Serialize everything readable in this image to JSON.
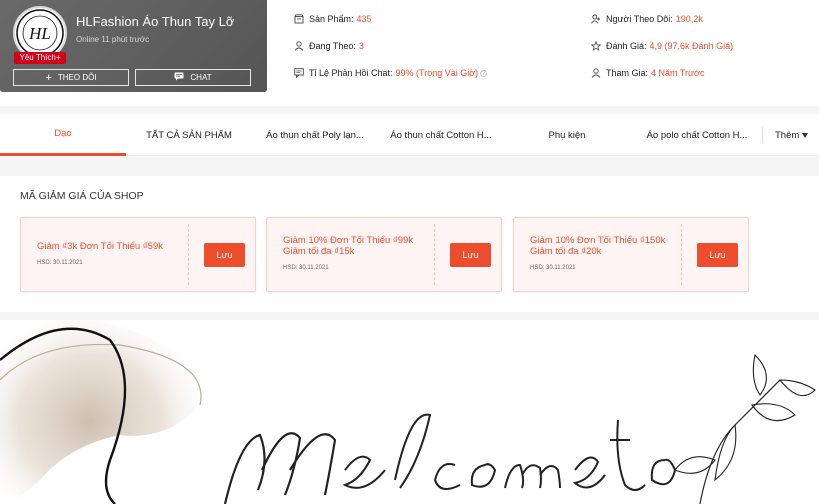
{
  "shop": {
    "name": "HLFashion Áo Thun Tay Lỡ",
    "online": "Online 11 phút trước",
    "badge": "Yêu Thích+",
    "logo_text": "HL",
    "follow_label": "THEO DÕI",
    "chat_label": "CHAT"
  },
  "stats": {
    "products": {
      "label": "Sản Phẩm:",
      "value": "435"
    },
    "following": {
      "label": "Đang Theo:",
      "value": "3"
    },
    "chat_rate": {
      "label": "Tỉ Lệ Phản Hồi Chat:",
      "value": "99% (Trong Vài Giờ)"
    },
    "followers": {
      "label": "Người Theo Dõi:",
      "value": "190,2k"
    },
    "rating": {
      "label": "Đánh Giá:",
      "value": "4,9 (97,6k Đánh Giá)"
    },
    "joined": {
      "label": "Tham Gia:",
      "value": "4 Năm Trước"
    }
  },
  "tabs": [
    {
      "label": "Dạo"
    },
    {
      "label": "TẤT CẢ SẢN PHẨM"
    },
    {
      "label": "Áo thun chất Poly lạn..."
    },
    {
      "label": "Áo thun chất Cotton H..."
    },
    {
      "label": "Phụ kiện"
    },
    {
      "label": "Áo polo chất Cotton H..."
    },
    {
      "label": "Thêm"
    }
  ],
  "vouchers": {
    "title": "MÃ GIẢM GIÁ CỦA SHOP",
    "items": [
      {
        "line1": "Giảm ₫3k Đơn Tối Thiểu ₫59k",
        "line2": "",
        "expiry": "HSD: 30.11.2021",
        "save": "Lưu"
      },
      {
        "line1": "Giảm 10% Đơn Tối Thiểu ₫99k",
        "line2": "Giảm tối đa ₫15k",
        "expiry": "HSD: 30.11.2021",
        "save": "Lưu"
      },
      {
        "line1": "Giảm 10% Đơn Tối Thiểu ₫150k",
        "line2": "Giảm tối đa ₫20k",
        "expiry": "HSD: 30.11.2021",
        "save": "Lưu"
      }
    ]
  },
  "banner": {
    "welcome": "Welcome to"
  },
  "colors": {
    "accent": "#ee4d2d",
    "header_card": "#5e5e5e"
  }
}
